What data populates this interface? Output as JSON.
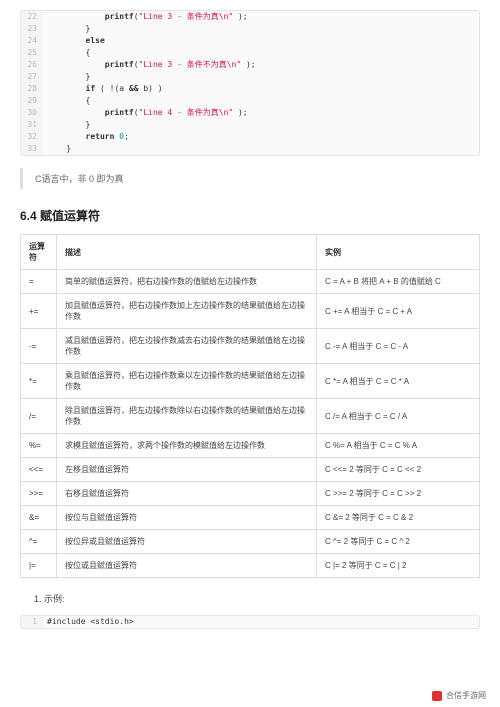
{
  "code1": {
    "start": 22,
    "lines": [
      {
        "indent": 3,
        "tokens": [
          {
            "t": "printf",
            "c": "kw"
          },
          {
            "t": "(",
            "c": "op"
          },
          {
            "t": "\"Line 3 - 条件为真\\n\"",
            "c": "str"
          },
          {
            "t": " );",
            "c": "op"
          }
        ]
      },
      {
        "indent": 2,
        "tokens": [
          {
            "t": "}",
            "c": "op"
          }
        ]
      },
      {
        "indent": 2,
        "tokens": [
          {
            "t": "else",
            "c": "kw"
          }
        ]
      },
      {
        "indent": 2,
        "tokens": [
          {
            "t": "{",
            "c": "op"
          }
        ]
      },
      {
        "indent": 3,
        "tokens": [
          {
            "t": "printf",
            "c": "kw"
          },
          {
            "t": "(",
            "c": "op"
          },
          {
            "t": "\"Line 3 - 条件不为真\\n\"",
            "c": "str"
          },
          {
            "t": " );",
            "c": "op"
          }
        ]
      },
      {
        "indent": 2,
        "tokens": [
          {
            "t": "}",
            "c": "op"
          }
        ]
      },
      {
        "indent": 2,
        "tokens": [
          {
            "t": "if",
            "c": "kw"
          },
          {
            "t": " ( !(a ",
            "c": "op"
          },
          {
            "t": "&&",
            "c": "kw"
          },
          {
            "t": " b) )",
            "c": "op"
          }
        ]
      },
      {
        "indent": 2,
        "tokens": [
          {
            "t": "{",
            "c": "op"
          }
        ]
      },
      {
        "indent": 3,
        "tokens": [
          {
            "t": "printf",
            "c": "kw"
          },
          {
            "t": "(",
            "c": "op"
          },
          {
            "t": "\"Line 4 - 条件为真\\n\"",
            "c": "str"
          },
          {
            "t": " );",
            "c": "op"
          }
        ]
      },
      {
        "indent": 2,
        "tokens": [
          {
            "t": "}",
            "c": "op"
          }
        ]
      },
      {
        "indent": 2,
        "tokens": [
          {
            "t": "return",
            "c": "kw"
          },
          {
            "t": " ",
            "c": "op"
          },
          {
            "t": "0",
            "c": "num"
          },
          {
            "t": ";",
            "c": "op"
          }
        ]
      },
      {
        "indent": 1,
        "tokens": [
          {
            "t": "}",
            "c": "op"
          }
        ]
      }
    ]
  },
  "quote": "C语言中，非 0 即为真",
  "heading": "6.4 赋值运算符",
  "table": {
    "headers": [
      "运算符",
      "描述",
      "实例"
    ],
    "rows": [
      {
        "op": "=",
        "desc": "简单的赋值运算符，把右边操作数的值赋给左边操作数",
        "ex": "C = A + B 将把 A + B 的值赋给 C"
      },
      {
        "op": "+=",
        "desc": "加且赋值运算符，把右边操作数加上左边操作数的结果赋值给左边操作数",
        "ex": "C += A 相当于 C = C + A"
      },
      {
        "op": "-=",
        "desc": "减且赋值运算符，把左边操作数减去右边操作数的结果赋值给左边操作数",
        "ex": "C -= A 相当于 C = C - A"
      },
      {
        "op": "*=",
        "desc": "乘且赋值运算符，把右边操作数乘以左边操作数的结果赋值给左边操作数",
        "ex": "C *= A 相当于 C = C * A"
      },
      {
        "op": "/=",
        "desc": "除且赋值运算符，把左边操作数除以右边操作数的结果赋值给左边操作数",
        "ex": "C /= A 相当于 C = C / A"
      },
      {
        "op": "%=",
        "desc": "求模且赋值运算符，求两个操作数的模赋值给左边操作数",
        "ex": "C %= A 相当于 C = C % A"
      },
      {
        "op": "<<=",
        "desc": "左移且赋值运算符",
        "ex": "C <<= 2 等同于 C = C << 2"
      },
      {
        "op": ">>=",
        "desc": "右移且赋值运算符",
        "ex": "C >>= 2 等同于 C = C >> 2"
      },
      {
        "op": "&=",
        "desc": "按位与且赋值运算符",
        "ex": "C &= 2 等同于 C = C & 2"
      },
      {
        "op": "^=",
        "desc": "按位异或且赋值运算符",
        "ex": "C ^= 2 等同于 C = C ^ 2"
      },
      {
        "op": "|=",
        "desc": "按位或且赋值运算符",
        "ex": "C |= 2 等同于 C = C | 2"
      }
    ]
  },
  "list_item": "1. 示例:",
  "code2": {
    "start": 1,
    "lines": [
      {
        "indent": 0,
        "tokens": [
          {
            "t": "#include <stdio.h>",
            "c": "op"
          }
        ]
      }
    ]
  },
  "footer": "合信手游网"
}
